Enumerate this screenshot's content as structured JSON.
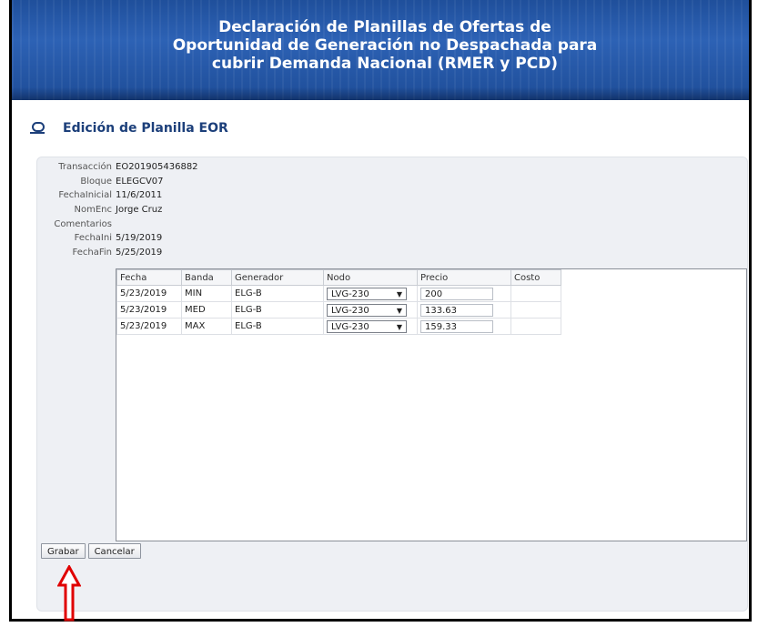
{
  "banner": {
    "line1": "Declaración de Planillas de Ofertas de",
    "line2": "Oportunidad de Generación no Despachada para",
    "line3": "cubrir Demanda Nacional (RMER y PCD)"
  },
  "page": {
    "title": "Edición de Planilla EOR"
  },
  "form": {
    "transaccion": {
      "label": "Transacción",
      "value": "EO201905436882"
    },
    "bloque": {
      "label": "Bloque",
      "value": "ELEGCV07"
    },
    "fecha_inicial": {
      "label": "FechaInicial",
      "value": "11/6/2011"
    },
    "nom_enc": {
      "label": "NomEnc",
      "value": "Jorge Cruz"
    },
    "comentarios": {
      "label": "Comentarios",
      "value": ""
    },
    "fecha_ini": {
      "label": "FechaIni",
      "value": "5/19/2019"
    },
    "fecha_fin": {
      "label": "FechaFin",
      "value": "5/25/2019"
    }
  },
  "grid": {
    "columns": [
      "Fecha",
      "Banda",
      "Generador",
      "Nodo",
      "Precio",
      "Costo"
    ],
    "rows": [
      {
        "fecha": "5/23/2019",
        "banda": "MIN",
        "generador": "ELG-B",
        "nodo": "LVG-230",
        "precio": "200",
        "costo": ""
      },
      {
        "fecha": "5/23/2019",
        "banda": "MED",
        "generador": "ELG-B",
        "nodo": "LVG-230",
        "precio": "133.63",
        "costo": ""
      },
      {
        "fecha": "5/23/2019",
        "banda": "MAX",
        "generador": "ELG-B",
        "nodo": "LVG-230",
        "precio": "159.33",
        "costo": ""
      }
    ]
  },
  "buttons": {
    "grabar": "Grabar",
    "cancelar": "Cancelar"
  },
  "colors": {
    "banner": "#2d62b5",
    "title": "#1c3f7a",
    "annotation_arrow": "#e00000"
  },
  "icons": {
    "dropdown": "▼"
  }
}
